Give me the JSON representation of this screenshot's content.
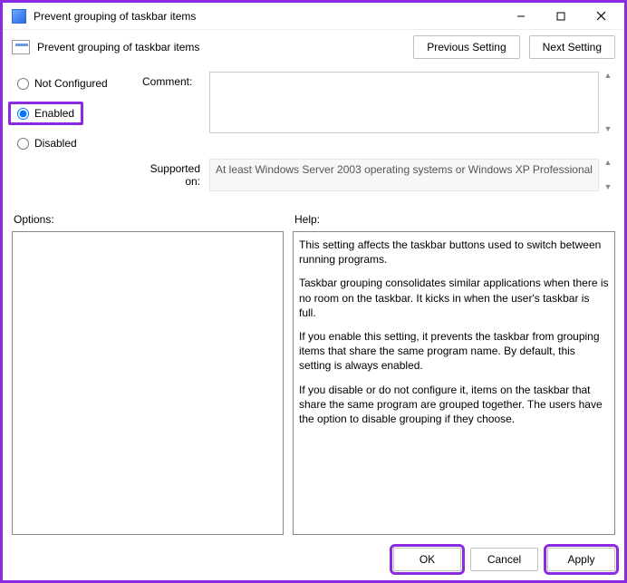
{
  "window": {
    "title": "Prevent grouping of taskbar items",
    "minimize_tip": "Minimize",
    "maximize_tip": "Maximize",
    "close_tip": "Close"
  },
  "header": {
    "subtitle": "Prevent grouping of taskbar items",
    "previous_label": "Previous Setting",
    "next_label": "Next Setting"
  },
  "state": {
    "not_configured_label": "Not Configured",
    "enabled_label": "Enabled",
    "disabled_label": "Disabled",
    "selected": "enabled"
  },
  "fields": {
    "comment_label": "Comment:",
    "comment_value": "",
    "supported_label": "Supported on:",
    "supported_value": "At least Windows Server 2003 operating systems or Windows XP Professional"
  },
  "panes": {
    "options_label": "Options:",
    "help_label": "Help:",
    "options_text": "",
    "help_paras": [
      "This setting affects the taskbar buttons used to switch between running programs.",
      "Taskbar grouping consolidates similar applications when there is no room on the taskbar. It kicks in when the user's taskbar is full.",
      "If you enable this setting, it prevents the taskbar from grouping items that share the same program name. By default, this setting is always enabled.",
      "If you disable or do not configure it, items on the taskbar that share the same program are grouped together. The users have the option to disable grouping if they choose."
    ]
  },
  "footer": {
    "ok_label": "OK",
    "cancel_label": "Cancel",
    "apply_label": "Apply"
  }
}
